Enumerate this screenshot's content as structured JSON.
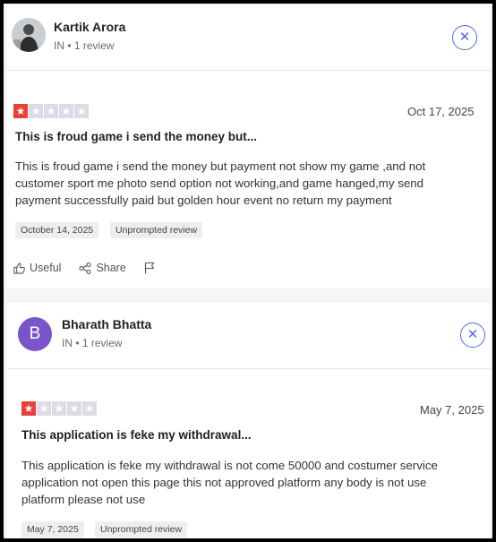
{
  "reviews": [
    {
      "user_name": "Kartik Arora",
      "user_meta": "IN • 1 review",
      "avatar_letter": "",
      "rating": 1,
      "date": "Oct 17, 2025",
      "title": "This is froud game i send the money but...",
      "body_lines": [
        "This is froud game i send the money but payment not show my game ,and not",
        "customer sport me photo send option not working,and game hanged,my send",
        "payment successfully paid but golden hour event no return my payment"
      ],
      "experience_date": "October 14, 2025",
      "tag": "Unprompted review",
      "actions": {
        "useful": "Useful",
        "share": "Share"
      }
    },
    {
      "user_name": "Bharath Bhatta",
      "user_meta": "IN • 1 review",
      "avatar_letter": "B",
      "rating": 1,
      "date": "May 7, 2025",
      "title": "This application is feke my withdrawal...",
      "body_lines": [
        "This application is feke my withdrawal is not come 50000 and costumer service",
        "application not open this page this not approved platform any body is not use",
        "platform please not use"
      ],
      "experience_date": "May 7, 2025",
      "tag": "Unprompted review"
    }
  ],
  "icons": {
    "close": "close-icon",
    "star": "star-icon",
    "useful": "thumbs-up-icon",
    "share": "share-icon",
    "flag": "flag-icon"
  },
  "colors": {
    "star_on": "#e8413a",
    "star_off": "#dcdce6",
    "avatar_b": "#7a55c9",
    "close": "#4a6cf0"
  }
}
